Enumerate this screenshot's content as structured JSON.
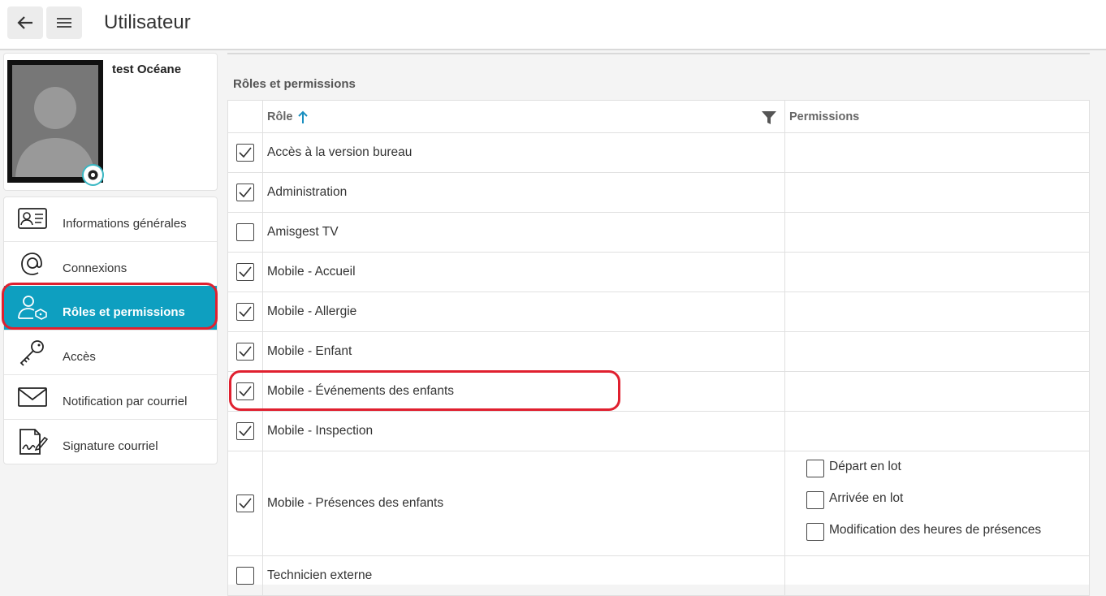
{
  "header": {
    "title": "Utilisateur",
    "back_icon": "arrow-left-icon",
    "menu_icon": "hamburger-menu-icon"
  },
  "profile": {
    "name": "test Océane",
    "camera_icon": "camera-icon"
  },
  "sidebar": {
    "items": [
      {
        "label": "Informations générales",
        "icon": "id-card-icon"
      },
      {
        "label": "Connexions",
        "icon": "at-sign-icon"
      },
      {
        "label": "Rôles et permissions",
        "icon": "user-tag-icon",
        "active": true
      },
      {
        "label": "Accès",
        "icon": "key-icon"
      },
      {
        "label": "Notification par courriel",
        "icon": "envelope-icon"
      },
      {
        "label": "Signature courriel",
        "icon": "signature-icon"
      }
    ]
  },
  "main": {
    "section_title": "Rôles et permissions",
    "columns": {
      "role": "Rôle",
      "permissions": "Permissions"
    },
    "rows": [
      {
        "label": "Accès à la version bureau",
        "checked": true
      },
      {
        "label": "Administration",
        "checked": true
      },
      {
        "label": "Amisgest TV",
        "checked": false
      },
      {
        "label": "Mobile - Accueil",
        "checked": true
      },
      {
        "label": "Mobile - Allergie",
        "checked": true
      },
      {
        "label": "Mobile - Enfant",
        "checked": true
      },
      {
        "label": "Mobile - Événements des enfants",
        "checked": true
      },
      {
        "label": "Mobile - Inspection",
        "checked": true
      },
      {
        "label": "Mobile - Présences des enfants",
        "checked": true,
        "permissions": [
          {
            "label": "Départ en lot",
            "checked": false
          },
          {
            "label": "Arrivée en lot",
            "checked": false
          },
          {
            "label": "Modification des heures de présences",
            "checked": false
          }
        ]
      },
      {
        "label": "Technicien externe",
        "checked": false
      }
    ]
  },
  "colors": {
    "accent": "#0e9fc0",
    "highlight": "#e0202f",
    "sort_arrow": "#1a8fc0"
  }
}
